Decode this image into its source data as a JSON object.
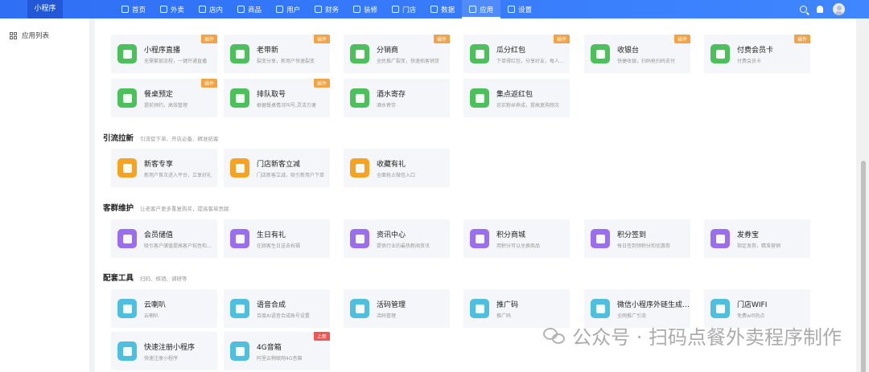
{
  "header": {
    "brand": "小程序",
    "nav": [
      {
        "label": "首页"
      },
      {
        "label": "外卖"
      },
      {
        "label": "店内"
      },
      {
        "label": "商品"
      },
      {
        "label": "用户"
      },
      {
        "label": "财务"
      },
      {
        "label": "装修"
      },
      {
        "label": "门店"
      },
      {
        "label": "数据"
      },
      {
        "label": "应用"
      },
      {
        "label": "设置"
      }
    ]
  },
  "sidebar": {
    "items": [
      {
        "label": "应用列表"
      }
    ]
  },
  "sections": [
    {
      "title": "",
      "subtitle": "",
      "cards": [
        {
          "name": "小程序直播",
          "desc": "无需繁琐流程，一键开通直播",
          "badge": "插件",
          "color": "#4cc05a",
          "icon": "tv-icon"
        },
        {
          "name": "老带新",
          "desc": "裂变分享，新用户快速裂变",
          "badge": "插件",
          "color": "#4cc05a",
          "icon": "user-icon"
        },
        {
          "name": "分销商",
          "desc": "全民推广裂变，快速拓客销货",
          "badge": "插件",
          "color": "#4cc05a",
          "icon": "image-icon"
        },
        {
          "name": "瓜分红包",
          "desc": "下单得红包，分享好友，每人…",
          "badge": "插件",
          "color": "#4cc05a",
          "icon": "redpacket-icon"
        },
        {
          "name": "收银台",
          "desc": "快捷收银，扫码枪扫码支付",
          "badge": "插件",
          "color": "#4cc05a",
          "icon": "monitor-icon"
        },
        {
          "name": "付费会员卡",
          "desc": "付费会员卡",
          "badge": "插件",
          "color": "#4cc05a",
          "icon": "card-icon"
        },
        {
          "name": "餐桌预定",
          "desc": "提前预约，高效管理",
          "badge": "插件",
          "color": "#4cc05a",
          "icon": "calendar-icon"
        },
        {
          "name": "排队取号",
          "desc": "根据餐桌情况叫号,灵活方便",
          "badge": "插件",
          "color": "#4cc05a",
          "icon": "hourglass-icon"
        },
        {
          "name": "酒水寄存",
          "desc": "酒水寄存",
          "badge": "",
          "color": "#4cc05a",
          "icon": "save-icon"
        },
        {
          "name": "集点返红包",
          "desc": "忠实粉丝养成，提高复购频次",
          "badge": "",
          "color": "#4cc05a",
          "icon": "redpacket-icon"
        }
      ]
    },
    {
      "title": "引流拉新",
      "subtitle": "引流促下单、开店必备、精准拓客",
      "cards": [
        {
          "name": "新客专享",
          "desc": "新用户首次进入平台，立享好礼",
          "badge": "",
          "color": "#f5a321",
          "icon": "gift-icon"
        },
        {
          "name": "门店新客立减",
          "desc": "门店新客立减，吸引新用户下单",
          "badge": "",
          "color": "#f5a321",
          "icon": "download-icon"
        },
        {
          "name": "收藏有礼",
          "desc": "全面抢占微信入口",
          "badge": "",
          "color": "#f5a321",
          "icon": "star-icon"
        }
      ]
    },
    {
      "title": "客群维护",
      "subtitle": "让老客户更多重复购买，提高客单贡献",
      "cards": [
        {
          "name": "会员储值",
          "desc": "吸引客户储值提高客户粘性和…",
          "badge": "",
          "color": "#9b6ef0",
          "icon": "bag-icon"
        },
        {
          "name": "生日有礼",
          "desc": "在顾客生日送去祝福",
          "badge": "",
          "color": "#9b6ef0",
          "icon": "cake-icon"
        },
        {
          "name": "资讯中心",
          "desc": "提供行业的最热新闻资讯",
          "badge": "",
          "color": "#9b6ef0",
          "icon": "news-icon"
        },
        {
          "name": "积分商城",
          "desc": "用积分可以兑换商品",
          "badge": "",
          "color": "#9b6ef0",
          "icon": "diamond-icon"
        },
        {
          "name": "积分签到",
          "desc": "每日签到领积分和优惠券",
          "badge": "",
          "color": "#9b6ef0",
          "icon": "calendar-check-icon"
        },
        {
          "name": "发券宝",
          "desc": "指定发券，精准营销",
          "badge": "",
          "color": "#9b6ef0",
          "icon": "grid-icon"
        }
      ]
    },
    {
      "title": "配套工具",
      "subtitle": "扫码、核销、调研等",
      "cards": [
        {
          "name": "云喇叭",
          "desc": "云喇叭",
          "badge": "",
          "color": "#4fbfdf",
          "icon": "bell-icon"
        },
        {
          "name": "语音合成",
          "desc": "百度AI语音合成账号设置",
          "badge": "",
          "color": "#4fbfdf",
          "icon": "mic-icon"
        },
        {
          "name": "活码管理",
          "desc": "活码管理",
          "badge": "",
          "color": "#4fbfdf",
          "icon": "link-icon"
        },
        {
          "name": "推广码",
          "desc": "推广码",
          "badge": "",
          "color": "#4fbfdf",
          "icon": "link-icon"
        },
        {
          "name": "微信小程序外链生成…",
          "desc": "全网推广引流",
          "badge": "",
          "color": "#4fbfdf",
          "icon": "link-icon"
        },
        {
          "name": "门店WIFI",
          "desc": "免费wifi热点",
          "badge": "",
          "color": "#4fbfdf",
          "icon": "link-icon"
        },
        {
          "name": "快速注册小程序",
          "desc": "快速注册小程序",
          "badge": "",
          "color": "#4fbfdf",
          "icon": "link-icon"
        },
        {
          "name": "4G音箱",
          "desc": "阿里云物联网4G音箱",
          "badge": "上新",
          "color": "#4fbfdf",
          "icon": "bell-icon"
        }
      ]
    }
  ],
  "watermark": "公众号 · 扫码点餐外卖程序制作"
}
